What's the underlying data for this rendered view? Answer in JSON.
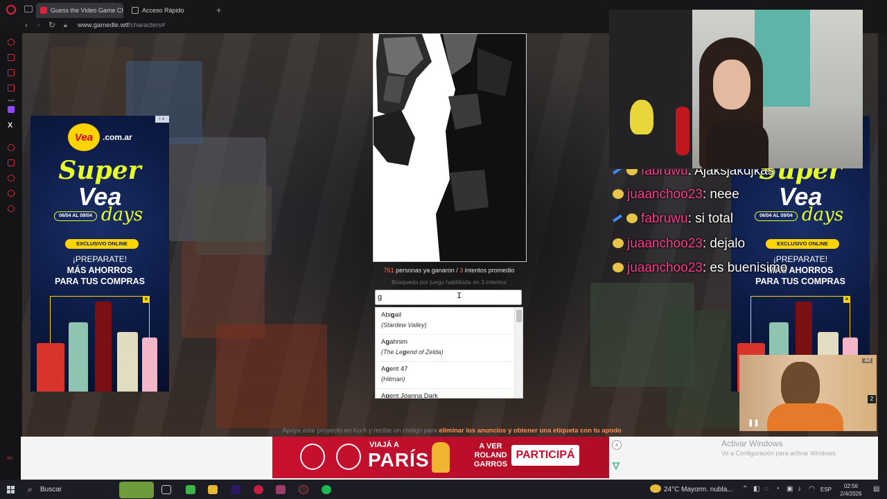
{
  "browser": {
    "tabs": [
      {
        "title": "Guess the Video Game Ch",
        "active": true
      },
      {
        "title": "Acceso Rápido",
        "active": false
      }
    ],
    "new_tab_symbol": "+",
    "url_host": "www.gamedle.wtf",
    "url_path": "/characters#",
    "nav": {
      "back": "‹",
      "forward": "›",
      "reload": "↻"
    }
  },
  "game": {
    "stats": {
      "winners": "761",
      "winners_text": " personas ya ganaron / ",
      "avg": "3",
      "avg_text": " intentos promedio"
    },
    "hint": "Búsqueda por juego habilitada en 3 intentos",
    "input_value": "g",
    "suggestions": [
      {
        "name_pre": "Abi",
        "name_hl": "g",
        "name_post": "ail",
        "game_pre": "(Stardew Valley)",
        "game_hl": "",
        "game_post": ""
      },
      {
        "name_pre": "A",
        "name_hl": "g",
        "name_post": "ahnim",
        "game_pre": "(The Le",
        "game_hl": "g",
        "game_post": "end of Zelda)"
      },
      {
        "name_pre": "A",
        "name_hl": "g",
        "name_post": "ent 47",
        "game_pre": "(Hitman)",
        "game_hl": "",
        "game_post": ""
      },
      {
        "name_pre": "A",
        "name_hl": "g",
        "name_post": "ent Joanna Dark",
        "game_pre": "",
        "game_hl": "",
        "game_post": ""
      }
    ],
    "kofi_text": "Apoya este proyecto en Ko-fi y recibe un código para ",
    "kofi_link": "eliminar los anuncios y obtener una etiqueta con tu apodo"
  },
  "vea_ad": {
    "domain": ".com.ar",
    "logo": "Vea",
    "super": "Super",
    "vea": "Vea",
    "days": "days",
    "dates": "06/04 AL 09/04",
    "exclusive": "EXCLUSIVO ONLINE",
    "prepare": "¡PREPARATE!",
    "more_savings_1": "MÁS AHORROS",
    "more_savings_2": "PARA TUS COMPRAS"
  },
  "stream_chat": [
    {
      "user": "fabruwu",
      "message": ": Ajaksjakdjkas",
      "mod": true
    },
    {
      "user": "juaanchoo23",
      "message": ": neee",
      "mod": false
    },
    {
      "user": "fabruwu",
      "message": ": si total",
      "mod": true
    },
    {
      "user": "juaanchoo23",
      "message": ": dejalo",
      "mod": false
    },
    {
      "user": "juaanchoo23",
      "message": ": es buenisimo",
      "mod": false
    }
  ],
  "video_ad": {
    "label": "Ad",
    "count": "2"
  },
  "banner_ad": {
    "headline_small": "VIAJÁ A",
    "headline_big": "PARÍS",
    "sub": "A VER ROLAND GARROS",
    "cta": "PARTICIPÁ"
  },
  "windows_watermark": {
    "title": "Activar Windows",
    "subtitle": "Ve a Configuración para activar Windows."
  },
  "taskbar": {
    "search_placeholder": "Buscar",
    "weather": "24°C  Mayorm. nubla...",
    "language": "ESP",
    "time": "02:56",
    "date": "2/4/2026"
  },
  "colors": {
    "accent": "#ff7043",
    "chat_name": "#ff3b8d",
    "opera_red": "#e0213a",
    "vea_yellow": "#e7ff2a",
    "stella_red": "#c8102e"
  }
}
